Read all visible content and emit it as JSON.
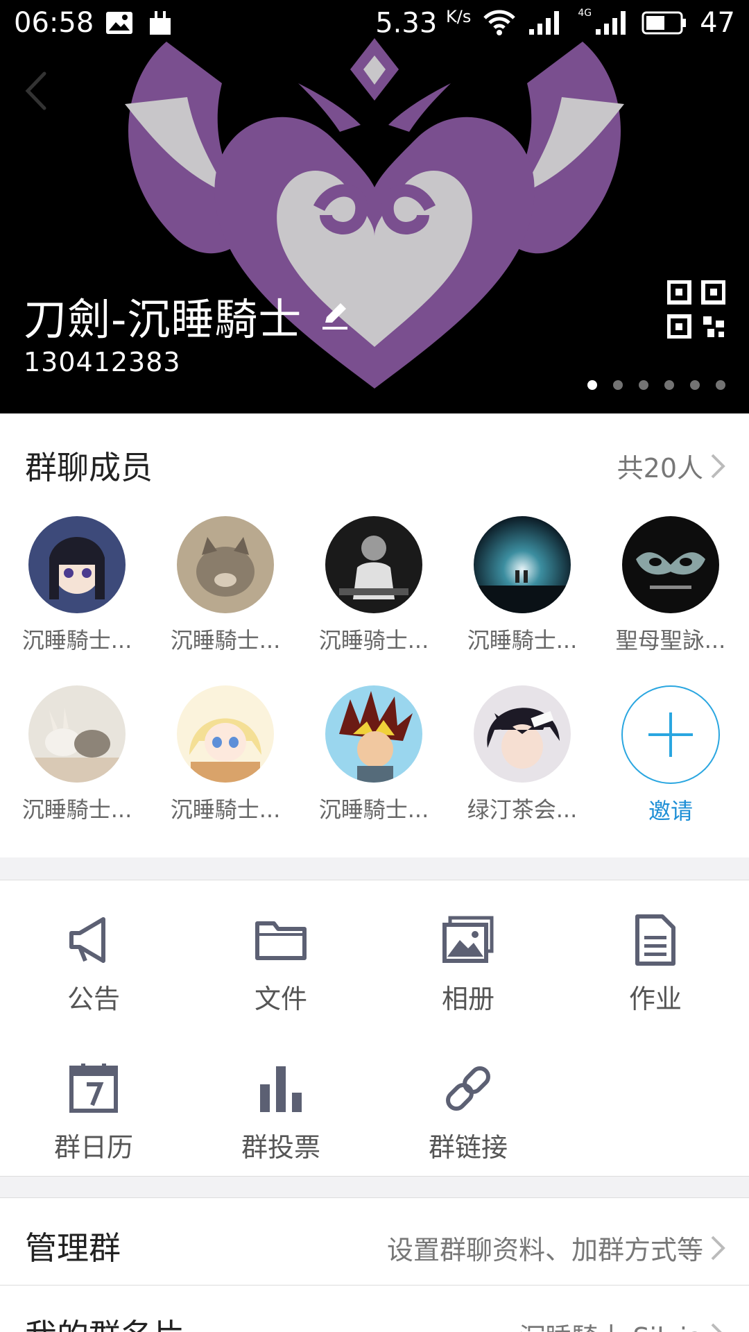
{
  "status_bar": {
    "time": "06:58",
    "speed": "5.33",
    "speed_unit": "K/s",
    "battery": "47",
    "network": "4G"
  },
  "header": {
    "group_name": "刀劍-沉睡騎士",
    "group_id": "130412383",
    "carousel_pages": 6,
    "carousel_active_index": 0
  },
  "members": {
    "title": "群聊成员",
    "count_label": "共20人",
    "items": [
      {
        "name": "沉睡騎士..."
      },
      {
        "name": "沉睡騎士..."
      },
      {
        "name": "沉睡骑士..."
      },
      {
        "name": "沉睡騎士..."
      },
      {
        "name": "聖母聖詠..."
      },
      {
        "name": "沉睡騎士..."
      },
      {
        "name": "沉睡騎士..."
      },
      {
        "name": "沉睡騎士..."
      },
      {
        "name": "绿汀茶会..."
      }
    ],
    "invite_label": "邀请",
    "accent": "#2aa6e0"
  },
  "functions": {
    "items": [
      {
        "label": "公告",
        "icon": "megaphone-icon"
      },
      {
        "label": "文件",
        "icon": "folder-icon"
      },
      {
        "label": "相册",
        "icon": "photo-album-icon"
      },
      {
        "label": "作业",
        "icon": "document-icon"
      },
      {
        "label": "群日历",
        "icon": "calendar-icon"
      },
      {
        "label": "群投票",
        "icon": "bar-chart-icon"
      },
      {
        "label": "群链接",
        "icon": "link-icon"
      }
    ]
  },
  "settings": {
    "manage": {
      "label": "管理群",
      "value": "设置群聊资料、加群方式等"
    },
    "card": {
      "label": "我的群名片",
      "value": "沉睡騎士 Silvia"
    }
  }
}
